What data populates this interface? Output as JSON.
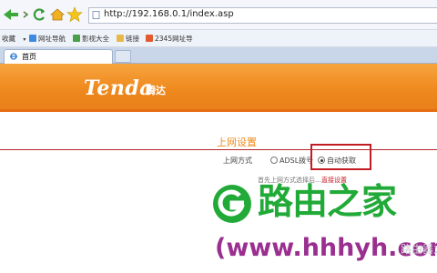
{
  "browser": {
    "address_url": "http://192.168.0.1/index.asp",
    "favorites": [
      {
        "label": "收藏",
        "icon": "chevron-down-icon"
      },
      {
        "label": "网址导航",
        "icon": "page-icon"
      },
      {
        "label": "影视大全",
        "icon": "page-icon"
      },
      {
        "label": "链接",
        "icon": "folder-icon"
      },
      {
        "label": "2345网址导",
        "icon": "page-icon"
      }
    ],
    "tab": {
      "label": "首页",
      "icon": "ie-icon"
    }
  },
  "banner": {
    "logo": "Tenda",
    "logo_cn": "腾达"
  },
  "settings": {
    "title": "上网设置",
    "mode_label": "上网方式",
    "options": [
      {
        "label": "ADSL拨号",
        "checked": false
      },
      {
        "label": "自动获取",
        "checked": true
      }
    ],
    "hint_prefix": "首先上网方式选择后…",
    "hint_link": "直接设置"
  },
  "watermark": {
    "title": "路由之家",
    "url": "(www.hhhyh.com",
    "right_text": "路由器之家"
  },
  "colors": {
    "banner_orange": "#f08a1d",
    "highlight_red": "#c21d24",
    "watermark_green": "#22aa38",
    "watermark_purple": "#9a2f90"
  }
}
